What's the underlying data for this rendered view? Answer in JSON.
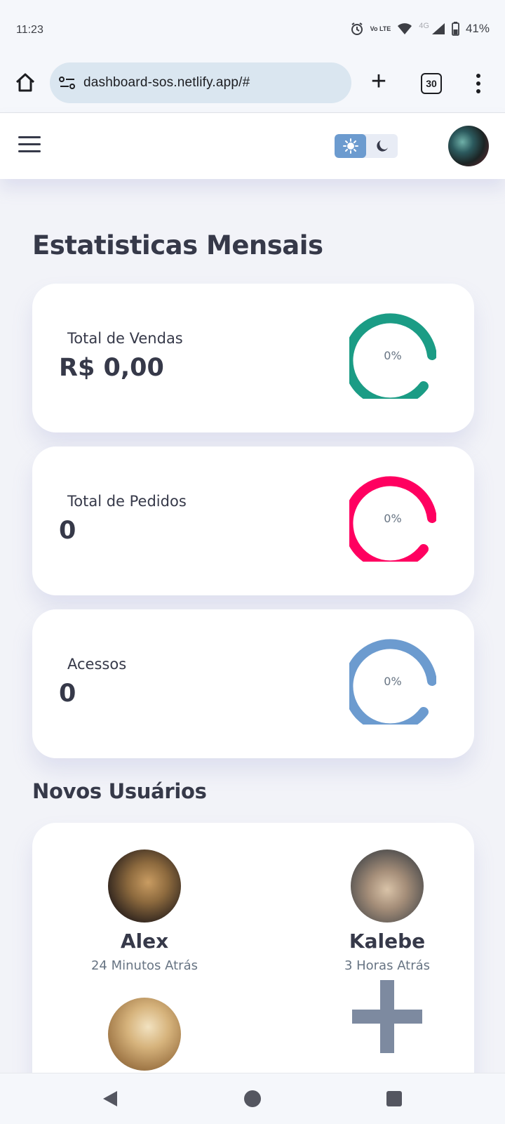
{
  "status": {
    "time": "11:23",
    "network": "4G",
    "volte": "Vo LTE",
    "battery": "41%"
  },
  "browser": {
    "url": "dashboard-sos.netlify.app/#",
    "tab_count": "30"
  },
  "header": {
    "theme_active": "light"
  },
  "main": {
    "title": "Estatisticas Mensais",
    "cards": [
      {
        "label": "Total de Vendas",
        "value": "R$ 0,00",
        "percent": "0%",
        "ring_color": "#1b9c85"
      },
      {
        "label": "Total de Pedidos",
        "value": "0",
        "percent": "0%",
        "ring_color": "#ff0060"
      },
      {
        "label": "Acessos",
        "value": "0",
        "percent": "0%",
        "ring_color": "#6c9bcf"
      }
    ]
  },
  "users": {
    "title": "Novos Usuários",
    "list": [
      {
        "name": "Alex",
        "time": "24 Minutos Atrás"
      },
      {
        "name": "Kalebe",
        "time": "3 Horas Atrás"
      },
      {
        "name": "",
        "time": ""
      }
    ]
  },
  "colors": {
    "primary": "#6c9bcf",
    "success": "#1b9c85",
    "danger": "#ff0060",
    "dark": "#363949",
    "background": "#f2f3f8"
  }
}
